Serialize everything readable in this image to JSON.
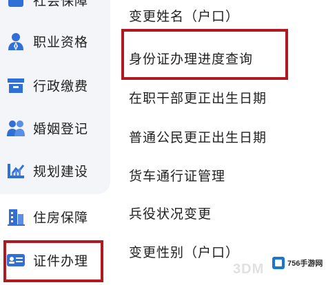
{
  "sidebar": {
    "items": [
      {
        "label": "社会保障",
        "icon": "social-security-icon"
      },
      {
        "label": "职业资格",
        "icon": "professional-qualification-icon"
      },
      {
        "label": "行政缴费",
        "icon": "administrative-payment-icon"
      },
      {
        "label": "婚姻登记",
        "icon": "marriage-registration-icon"
      },
      {
        "label": "规划建设",
        "icon": "planning-construction-icon"
      },
      {
        "label": "住房保障",
        "icon": "housing-security-icon"
      },
      {
        "label": "证件办理",
        "icon": "id-card-icon"
      }
    ],
    "highlighted_item": "证件办理"
  },
  "menu": {
    "items": [
      "变更姓名（户口）",
      "身份证办理进度查询",
      "在职干部更正出生日期",
      "普通公民更正出生日期",
      "货车通行证管理",
      "兵役状况变更",
      "变更性别（户口）"
    ],
    "highlighted_item": "身份证办理进度查询"
  },
  "watermark": {
    "brand": "756手游网",
    "secondary": "3DM"
  },
  "colors": {
    "highlight_border": "#b0191f",
    "icon_blue": "#2f6fd6",
    "sidebar_bg": "#f3f5f9",
    "text": "#222222"
  }
}
